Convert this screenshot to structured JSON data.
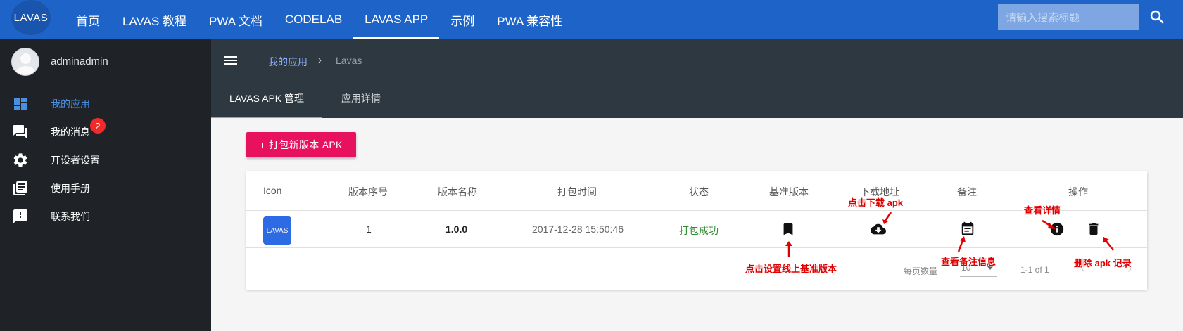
{
  "header": {
    "logo": "LAVAS",
    "nav": [
      "首页",
      "LAVAS 教程",
      "PWA 文档",
      "CODELAB",
      "LAVAS APP",
      "示例",
      "PWA 兼容性"
    ],
    "active_nav": "LAVAS APP",
    "search_placeholder": "请输入搜索标题"
  },
  "sidebar": {
    "username": "adminadmin",
    "items": [
      {
        "label": "我的应用",
        "icon": "dashboard-icon",
        "active": true
      },
      {
        "label": "我的消息",
        "icon": "forum-icon",
        "badge": "2"
      },
      {
        "label": "开设者设置",
        "icon": "settings-gear-icon"
      },
      {
        "label": "使用手册",
        "icon": "library-books-icon"
      },
      {
        "label": "联系我们",
        "icon": "feedback-icon"
      }
    ]
  },
  "breadcrumb": {
    "parent": "我的应用",
    "separator": "›",
    "current": "Lavas"
  },
  "tabs": [
    "LAVAS APK 管理",
    "应用详情"
  ],
  "new_button": "+ 打包新版本 APK",
  "table": {
    "columns": [
      "Icon",
      "版本序号",
      "版本名称",
      "打包时间",
      "状态",
      "基准版本",
      "下载地址",
      "备注",
      "操作"
    ],
    "rows": [
      {
        "icon_text": "LAVAS",
        "version_code": "1",
        "version_name": "1.0.0",
        "build_time": "2017-12-28 15:50:46",
        "status": "打包成功"
      }
    ],
    "footer": {
      "rows_per_page_label": "每页数量",
      "rows_per_page": "10",
      "range": "1-1 of 1"
    }
  },
  "annotations": {
    "baseline": "点击设置线上基准版本",
    "download": "点击下载 apk",
    "note": "查看备注信息",
    "detail": "查看详情",
    "delete": "删除 apk 记录"
  },
  "colors": {
    "topbar": "#1e64c8",
    "sidebar": "#1f2328",
    "content_header": "#2d3840",
    "primary_button": "#e8115e",
    "status_success": "#2e8b2e",
    "annotation": "#e00000"
  }
}
